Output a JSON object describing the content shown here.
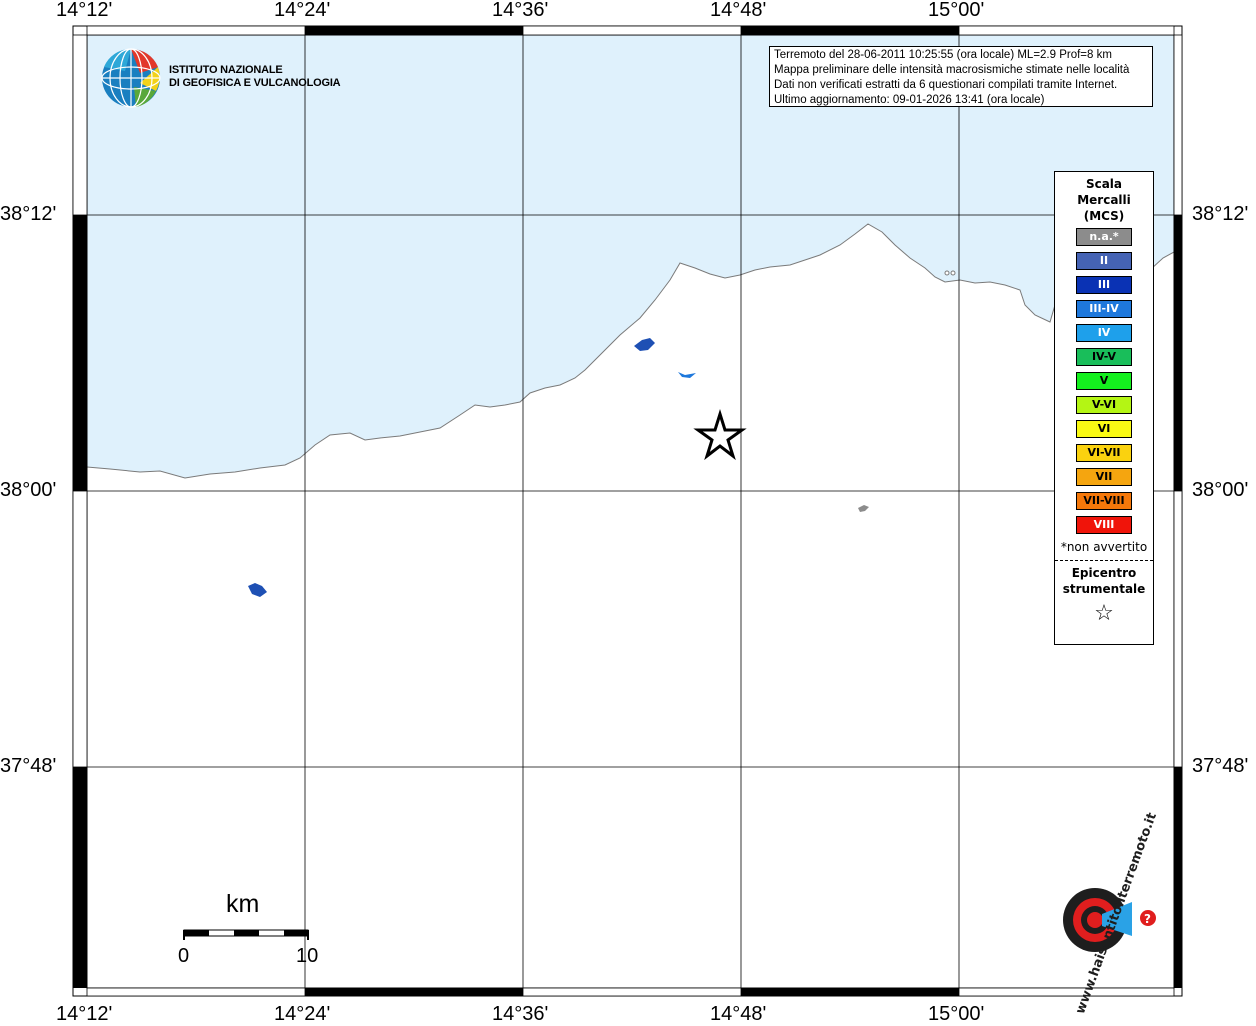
{
  "map": {
    "lon_ticks_top": [
      "14°12'",
      "14°24'",
      "14°36'",
      "14°48'",
      "15°00'"
    ],
    "lon_ticks_bottom": [
      "14°12'",
      "14°24'",
      "14°36'",
      "14°48'",
      "15°00'"
    ],
    "lat_ticks_left": [
      "38°12'",
      "38°00'",
      "37°48'"
    ],
    "lat_ticks_right": [
      "38°12'",
      "38°00'",
      "37°48'"
    ],
    "sea_color": "#dff1fc",
    "land_color": "#ffffff",
    "lake_color": "#1e50b4"
  },
  "info": {
    "lines": [
      "Terremoto del 28-06-2011 10:25:55 (ora locale) ML=2.9 Prof=8 km",
      "Mappa preliminare delle intensità macrosismiche stimate nelle località",
      "Dati non verificati estratti da 6 questionari compilati tramite Internet.",
      "Ultimo aggiornamento: 09-01-2026 13:41 (ora locale)"
    ]
  },
  "ingv": {
    "line1": "ISTITUTO NAZIONALE",
    "line2": "DI GEOFISICA E VULCANOLOGIA"
  },
  "legend": {
    "title_line1": "Scala",
    "title_line2": "Mercalli",
    "title_line3": "(MCS)",
    "items": [
      {
        "label": "n.a.*",
        "color": "#8c8c8c"
      },
      {
        "label": "II",
        "color": "#4563b4"
      },
      {
        "label": "III",
        "color": "#0a32b4"
      },
      {
        "label": "III-IV",
        "color": "#1e78dc"
      },
      {
        "label": "IV",
        "color": "#1ea0eb"
      },
      {
        "label": "IV-V",
        "color": "#19be5a"
      },
      {
        "label": "V",
        "color": "#14f01e"
      },
      {
        "label": "V-VI",
        "color": "#b4f514"
      },
      {
        "label": "VI",
        "color": "#fafa14"
      },
      {
        "label": "VI-VII",
        "color": "#fad20f"
      },
      {
        "label": "VII",
        "color": "#f5a50f"
      },
      {
        "label": "VII-VIII",
        "color": "#f5780a"
      },
      {
        "label": "VIII",
        "color": "#f0140a"
      }
    ],
    "note": "*non avvertito",
    "epicenter_line1": "Epicentro",
    "epicenter_line2": "strumentale",
    "epicenter_symbol": "☆"
  },
  "scale_bar": {
    "unit": "km",
    "start": "0",
    "end": "10"
  },
  "hsit": {
    "text": "www.haisentitoilterremoto.it"
  }
}
